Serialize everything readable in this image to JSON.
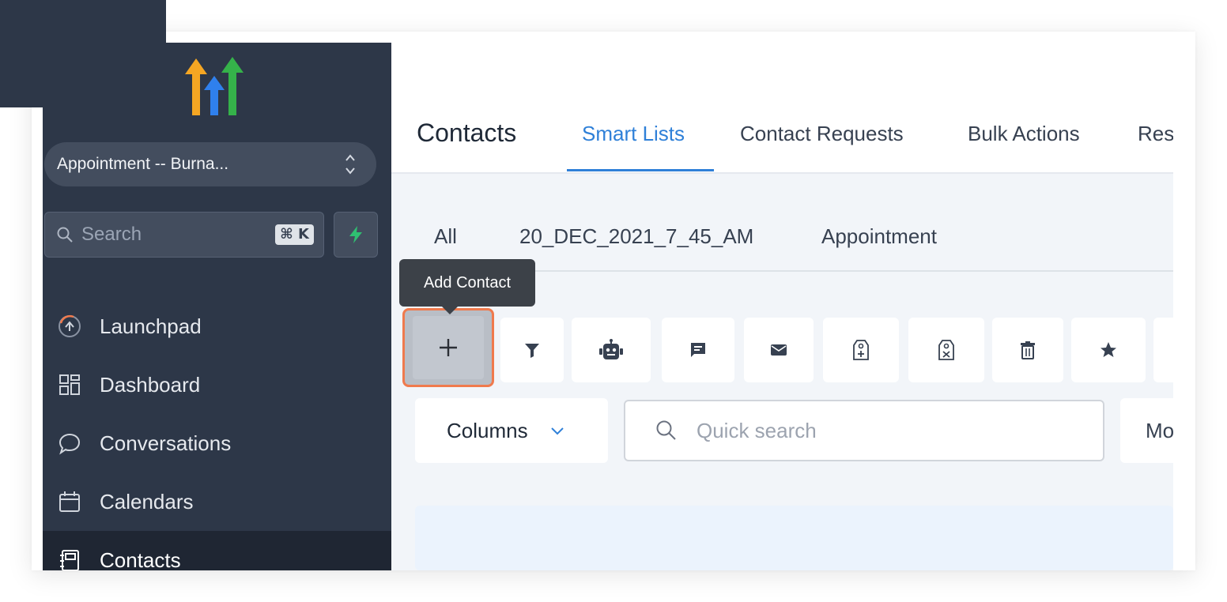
{
  "sidebar": {
    "location_selector": "Appointment -- Burna...",
    "search": {
      "placeholder": "Search",
      "shortcut": "⌘ K"
    },
    "nav": [
      {
        "label": "Launchpad",
        "icon": "launchpad-icon"
      },
      {
        "label": "Dashboard",
        "icon": "dashboard-icon"
      },
      {
        "label": "Conversations",
        "icon": "chat-bubble-icon"
      },
      {
        "label": "Calendars",
        "icon": "calendar-icon"
      },
      {
        "label": "Contacts",
        "icon": "contacts-book-icon",
        "active": true
      }
    ]
  },
  "header": {
    "title": "Contacts",
    "tabs": [
      {
        "label": "Smart Lists",
        "active": true
      },
      {
        "label": "Contact Requests"
      },
      {
        "label": "Bulk Actions"
      },
      {
        "label": "Res"
      }
    ]
  },
  "smart_lists": [
    "All",
    "20_DEC_2021_7_45_AM",
    "Appointment"
  ],
  "tooltip": "Add Contact",
  "toolbar": {
    "buttons": [
      "add-contact-icon",
      "filter-icon",
      "robot-icon",
      "message-icon",
      "email-icon",
      "add-tag-icon",
      "remove-tag-icon",
      "delete-icon",
      "star-icon"
    ]
  },
  "filters": {
    "columns_label": "Columns",
    "quick_search_placeholder": "Quick search",
    "more_label": "Mo"
  },
  "colors": {
    "sidebar_bg": "#2d3748",
    "accent": "#2f80d8",
    "highlight": "#f07a4d",
    "bolt": "#2fbf71"
  }
}
